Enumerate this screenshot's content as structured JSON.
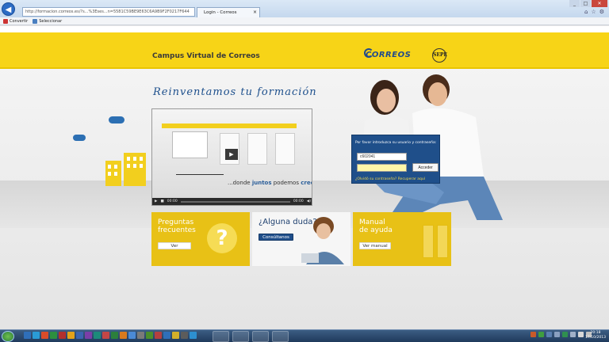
{
  "browser": {
    "address": "http://formacion.correos.es/?s...%3Eses...n=5581C59BE9E63C6A9B9F2F0217F644",
    "tab_title": "Login - Correos",
    "tab_close": "×",
    "back_icon": "back-arrow-icon",
    "window_buttons": [
      "_",
      "□",
      "✕"
    ],
    "toolbar_icons": [
      "⌂",
      "☆",
      "⚙"
    ],
    "command_bar": [
      {
        "label": "Convertir",
        "icon": "pdf-icon"
      },
      {
        "label": "Seleccionar",
        "icon": "select-icon"
      }
    ]
  },
  "header": {
    "campus_title": "Campus Virtual de Correos",
    "logo_text": "CORREOS",
    "sepe_text": "SEPE"
  },
  "hero": {
    "headline": "Reinventamos tu formación"
  },
  "video": {
    "caption_prefix": "...donde ",
    "caption_bold": "juntos",
    "caption_middle": " podemos ",
    "caption_end": "crecer",
    "time_current": "00:00",
    "time_total": "00:00",
    "controls": [
      "▶",
      "■",
      "◀)"
    ]
  },
  "login": {
    "prompt": "Por favor introduzca su usuario y contraseña:",
    "username_value": "c602041",
    "password_value": "",
    "submit_label": "Acceder",
    "forgot_text": "¿Olvidó su contraseña? Recuperar aquí"
  },
  "tiles": [
    {
      "title_line1": "Preguntas",
      "title_line2": "frecuentes",
      "button": "Ver",
      "icon": "question-icon"
    },
    {
      "title_line1": "¿Alguna duda?",
      "title_line2": "",
      "button": "Consúltanos",
      "icon": "student-photo"
    },
    {
      "title_line1": "Manual",
      "title_line2": "de ayuda",
      "button": "Ver manual",
      "icon": "binders-icon"
    }
  ],
  "taskbar": {
    "clock_time": "20:18",
    "clock_date": "17/10/2013"
  },
  "colors": {
    "banner_yellow": "#f7d417",
    "correos_blue": "#1f4f8a",
    "tile_yellow": "#e8c116"
  }
}
